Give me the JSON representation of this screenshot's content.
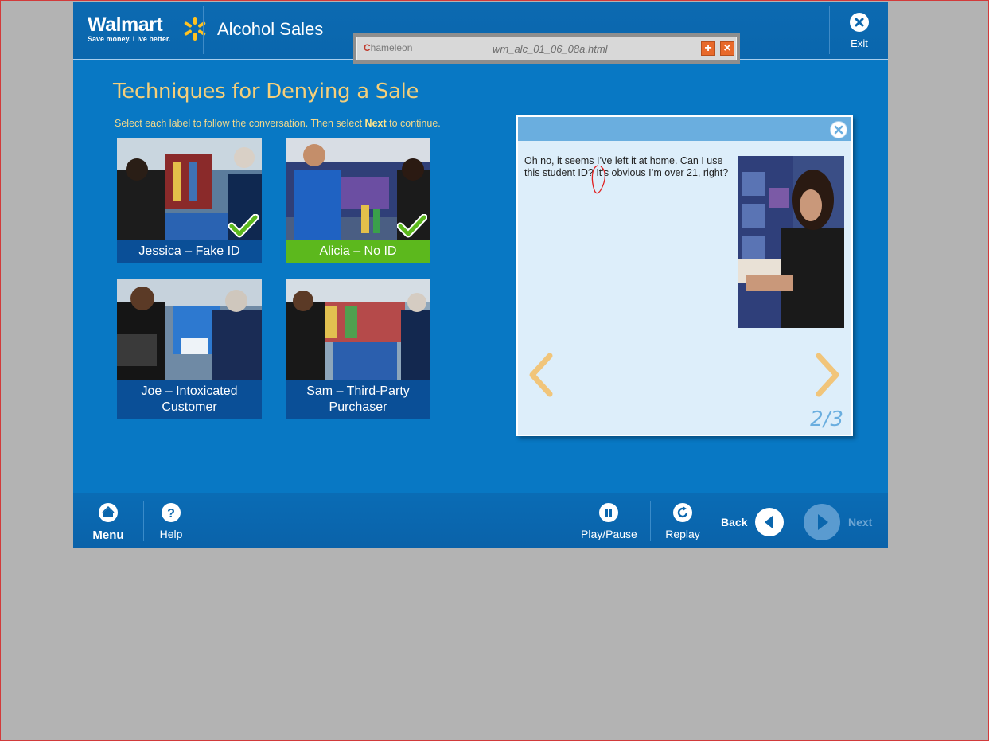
{
  "header": {
    "logo_text": "Walmart",
    "logo_tagline": "Save money. Live better.",
    "app_title": "Alcohol Sales",
    "exit_label": "Exit"
  },
  "popup": {
    "brand": "hameleon",
    "filename": "wm_alc_01_06_08a.html"
  },
  "content": {
    "title": "Techniques for Denying a Sale",
    "instructions_before": "Select each label to follow the conversation.  Then select ",
    "instructions_bold": "Next",
    "instructions_after": " to continue."
  },
  "tiles": [
    {
      "label": "Jessica – Fake ID",
      "completed": true,
      "active": false
    },
    {
      "label": "Alicia – No ID",
      "completed": true,
      "active": true
    },
    {
      "label": "Joe – Intoxicated Customer",
      "completed": false,
      "active": false
    },
    {
      "label": "Sam – Third-Party Purchaser",
      "completed": false,
      "active": false
    }
  ],
  "dialog": {
    "text": "Oh no, it seems I’ve left it at home.  Can I use this student ID? It’s obvious I’m over 21, right?",
    "page": "2/3"
  },
  "footer": {
    "menu": "Menu",
    "help": "Help",
    "play_pause": "Play/Pause",
    "replay": "Replay",
    "back": "Back",
    "next": "Next"
  },
  "colors": {
    "brand_blue": "#0878c4",
    "title_gold": "#f5cf7a",
    "active_green": "#5cb81d",
    "caption_blue": "#0a4f97"
  }
}
